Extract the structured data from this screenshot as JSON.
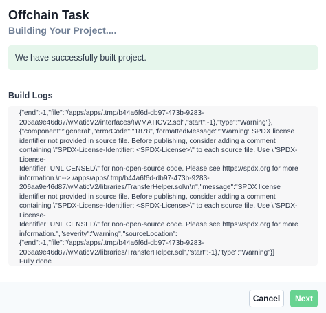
{
  "header": {
    "title": "Offchain Task",
    "subtitle": "Building Your Project...."
  },
  "alert": {
    "message": "We have successfully built project."
  },
  "logs": {
    "heading": "Build Logs",
    "lines": [
      "{\"end\":-1,\"file\":\"/apps/apps/.tmp/b44a6f6d-db97-473b-9283-",
      "206aa9e46d87/wMaticV2/interfaces/IWMATICV2.sol\",\"start\":-1},\"type\":\"Warning\"},",
      "{\"component\":\"general\",\"errorCode\":\"1878\",\"formattedMessage\":\"Warning: SPDX license",
      "identifier not provided in source file. Before publishing, consider adding a comment",
      "containing \\\"SPDX-License-Identifier: <SPDX-License>\\\" to each source file. Use \\\"SPDX-License-",
      "Identifier: UNLICENSED\\\" for non-open-source code. Please see https://spdx.org for more",
      "information.\\n--> /apps/apps/.tmp/b44a6f6d-db97-473b-9283-",
      "206aa9e46d87/wMaticV2/libraries/TransferHelper.sol\\n\\n\",\"message\":\"SPDX license",
      "identifier not provided in source file. Before publishing, consider adding a comment",
      "containing \\\"SPDX-License-Identifier: <SPDX-License>\\\" to each source file. Use \\\"SPDX-License-",
      "Identifier: UNLICENSED\\\" for non-open-source code. Please see https://spdx.org for more",
      "information.\",\"severity\":\"warning\",\"sourceLocation\":",
      "{\"end\":-1,\"file\":\"/apps/apps/.tmp/b44a6f6d-db97-473b-9283-",
      "206aa9e46d87/wMaticV2/libraries/TransferHelper.sol\",\"start\":-1},\"type\":\"Warning\"}]",
      "Fully done"
    ]
  },
  "footer": {
    "cancel_label": "Cancel",
    "next_label": "Next"
  },
  "colors": {
    "alert_bg": "#e6f6ec",
    "next_button": "#68d391",
    "logs_bg": "#f7f7f8",
    "subtitle": "#718096"
  }
}
